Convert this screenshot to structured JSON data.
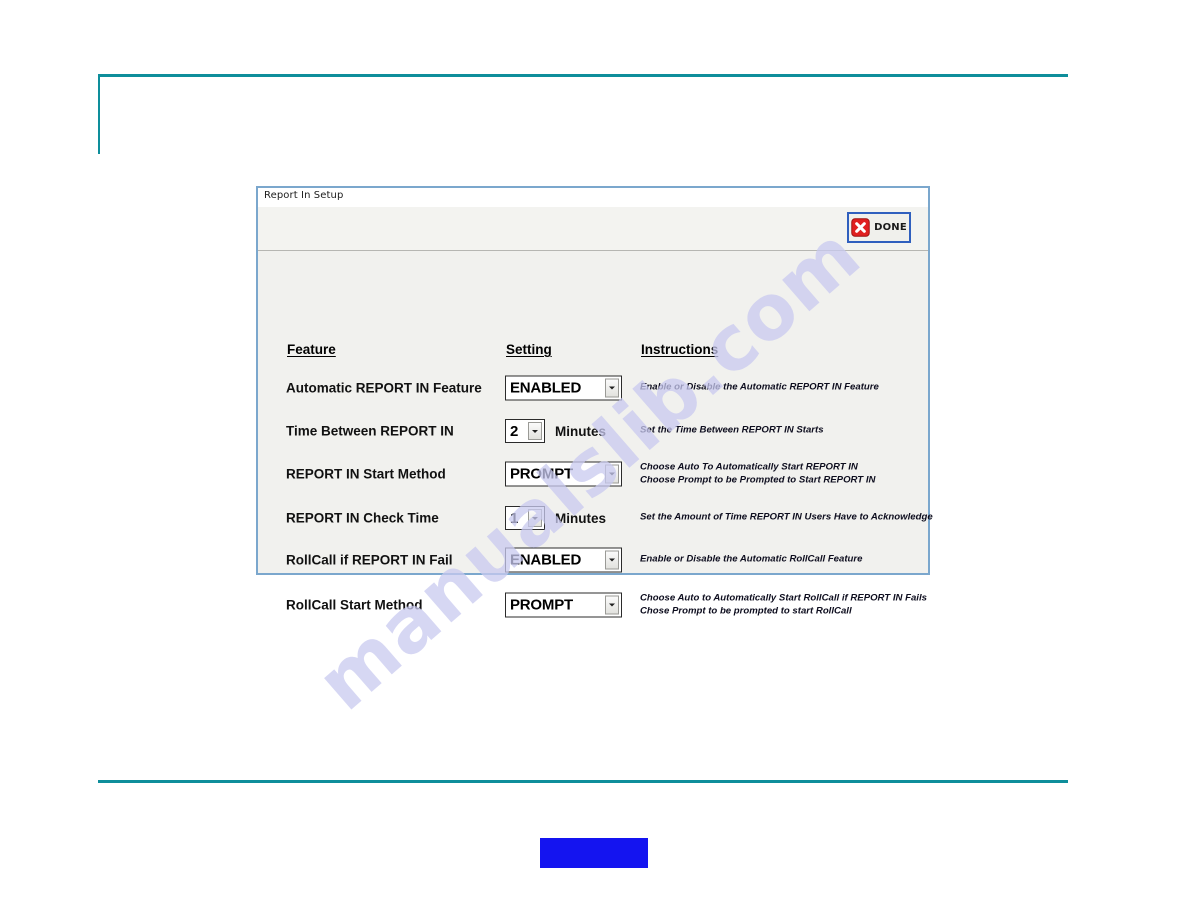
{
  "page": {
    "watermark": "manualslib.com",
    "accent_teal": "#0e8e9b",
    "footer_block_color": "#1414f0"
  },
  "window": {
    "title": "Report In Setup",
    "border_color": "#7ba7cd",
    "background": "#f1f1ee",
    "toolbar": {
      "done_button": {
        "label": "DONE",
        "icon": "red-x-close-icon",
        "icon_color": "#e02020",
        "border_color": "#2f5fbe"
      }
    },
    "columns": {
      "feature": "Feature",
      "setting": "Setting",
      "instructions": "Instructions"
    },
    "rows": [
      {
        "label": "Automatic REPORT IN Feature",
        "control": "dropdown",
        "value": "ENABLED",
        "unit": "",
        "instructions": [
          "Enable or Disable the Automatic REPORT IN Feature"
        ]
      },
      {
        "label": "Time Between REPORT IN",
        "control": "spinner",
        "value": "2",
        "unit": "Minutes",
        "instructions": [
          "Set the Time Between REPORT IN Starts"
        ]
      },
      {
        "label": "REPORT IN Start Method",
        "control": "dropdown",
        "value": "PROMPT",
        "unit": "",
        "instructions": [
          "Choose Auto To Automatically Start REPORT IN",
          "Choose Prompt to be Prompted to Start REPORT IN"
        ]
      },
      {
        "label": "REPORT IN Check Time",
        "control": "spinner",
        "value": "1",
        "unit": "Minutes",
        "instructions": [
          "Set the Amount of Time REPORT IN Users Have to Acknowledge"
        ]
      },
      {
        "label": "RollCall if REPORT IN Fail",
        "control": "dropdown",
        "value": "ENABLED",
        "unit": "",
        "instructions": [
          "Enable or Disable the Automatic RollCall Feature"
        ]
      },
      {
        "label": "RollCall Start Method",
        "control": "dropdown",
        "value": "PROMPT",
        "unit": "",
        "instructions": [
          "Choose Auto to Automatically Start RollCall if REPORT IN Fails",
          "Chose Prompt to be prompted to start RollCall"
        ]
      }
    ]
  }
}
